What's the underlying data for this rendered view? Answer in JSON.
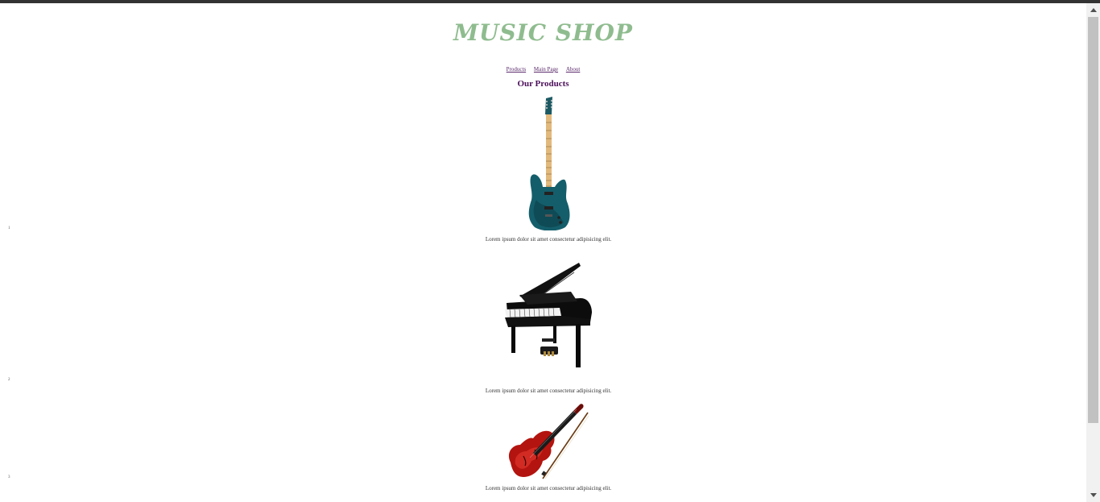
{
  "header": {
    "logo_text": "MUSIC SHOP"
  },
  "nav": {
    "items": [
      {
        "label": "Products"
      },
      {
        "label": "Main Page"
      },
      {
        "label": "About"
      }
    ]
  },
  "main": {
    "heading": "Our Products",
    "products": [
      {
        "number": "1",
        "image": "electric-guitar",
        "description": "Lorem ipsum dolor sit amet consectetur adipisicing elit."
      },
      {
        "number": "2",
        "image": "grand-piano",
        "description": "Lorem ipsum dolor sit amet consectetur adipisicing elit."
      },
      {
        "number": "3",
        "image": "violin",
        "description": "Lorem ipsum dolor sit amet consectetur adipisicing elit."
      }
    ]
  },
  "colors": {
    "logo": "#8fbc8f",
    "nav_link": "#5a2a6a",
    "heading": "#4b0f5a",
    "top_bar": "#333333"
  }
}
